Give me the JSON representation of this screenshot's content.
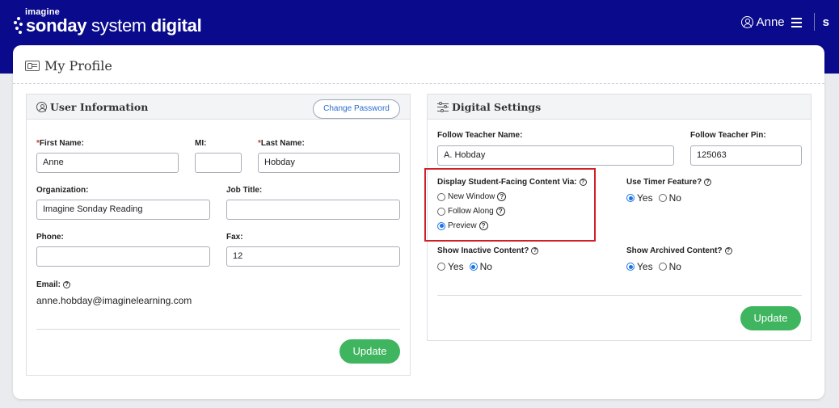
{
  "header": {
    "logo_small": "imagine",
    "logo_bold": "sonday",
    "logo_light": "system",
    "logo_end": "digital",
    "user_name": "Anne",
    "brand_glyph": "s",
    "icons": [
      "user-circle-icon",
      "hamburger-menu-icon",
      "brand-s-icon"
    ]
  },
  "page": {
    "title": "My Profile",
    "title_icon": "id-card-icon"
  },
  "user_info": {
    "title": "User Information",
    "change_password": "Change Password",
    "first_name_label": "First Name:",
    "first_name": "Anne",
    "mi_label": "MI:",
    "mi": "",
    "last_name_label": "Last Name:",
    "last_name": "Hobday",
    "organization_label": "Organization:",
    "organization": "Imagine Sonday Reading",
    "job_title_label": "Job Title:",
    "job_title": "",
    "phone_label": "Phone:",
    "phone": "",
    "fax_label": "Fax:",
    "fax": "12",
    "email_label": "Email:",
    "email": "anne.hobday@imaginelearning.com",
    "update": "Update",
    "required_mark": "*",
    "help_glyph": "?"
  },
  "digital_settings": {
    "title": "Digital Settings",
    "follow_teacher_name_label": "Follow Teacher Name:",
    "follow_teacher_name": "A. Hobday",
    "follow_teacher_pin_label": "Follow Teacher Pin:",
    "follow_teacher_pin": "125063",
    "display_label": "Display Student-Facing Content Via:",
    "display_options": [
      "New Window",
      "Follow Along",
      "Preview"
    ],
    "display_selected": "Preview",
    "timer_label": "Use Timer Feature?",
    "timer_selected": "Yes",
    "inactive_label": "Show Inactive Content?",
    "inactive_selected": "No",
    "archived_label": "Show Archived Content?",
    "archived_selected": "Yes",
    "yes": "Yes",
    "no": "No",
    "update": "Update",
    "help_glyph": "?"
  },
  "colors": {
    "header_bg": "#0a0a8c",
    "update_green": "#3fb55f",
    "radio_blue": "#1a73e8",
    "highlight_red": "#d01f26",
    "link_blue": "#2a6fd1"
  }
}
